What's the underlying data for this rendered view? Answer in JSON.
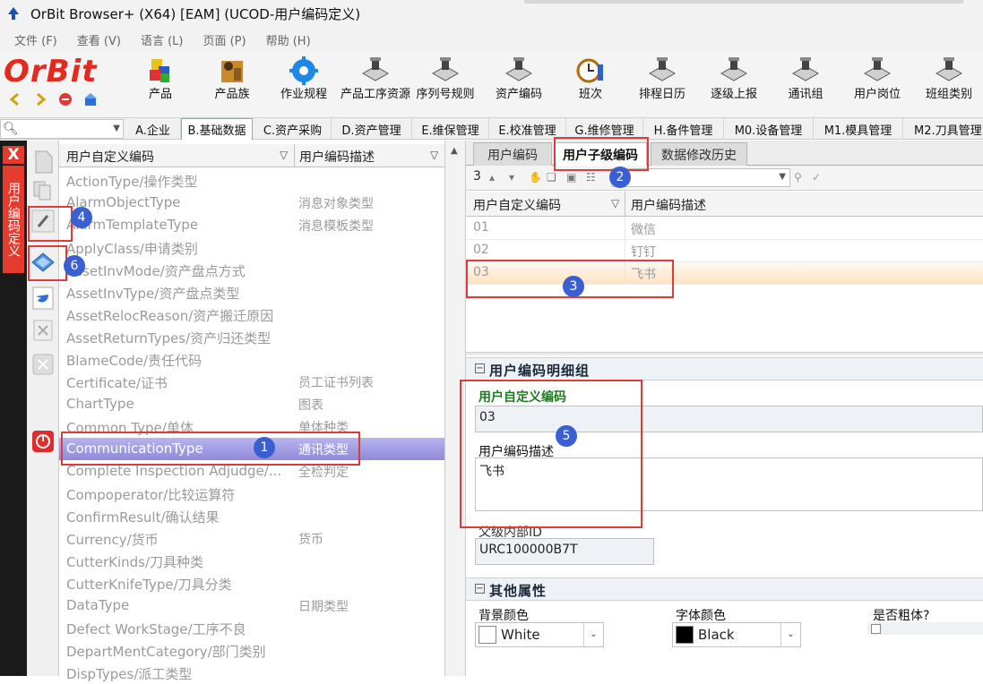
{
  "window": {
    "title": "OrBit Browser+ (X64) [EAM] (UCOD-用户编码定义)"
  },
  "menu": [
    "文件 (F)",
    "查看 (V)",
    "语言 (L)",
    "页面 (P)",
    "帮助 (H)"
  ],
  "logo": "OrBit",
  "toolbar": [
    {
      "label": "产品",
      "icon": "product-icon"
    },
    {
      "label": "产品族",
      "icon": "product-family-icon"
    },
    {
      "label": "作业规程",
      "icon": "gear-icon"
    },
    {
      "label": "产品工序资源",
      "icon": "process-resource-icon"
    },
    {
      "label": "序列号规则",
      "icon": "serial-rule-icon"
    },
    {
      "label": "资产编码",
      "icon": "asset-code-icon"
    },
    {
      "label": "班次",
      "icon": "clock-icon"
    },
    {
      "label": "排程日历",
      "icon": "calendar-icon"
    },
    {
      "label": "逐级上报",
      "icon": "report-icon"
    },
    {
      "label": "通讯组",
      "icon": "comm-group-icon"
    },
    {
      "label": "用户岗位",
      "icon": "user-post-icon"
    },
    {
      "label": "班组类别",
      "icon": "team-type-icon"
    }
  ],
  "module_tabs": [
    "A.企业",
    "B.基础数据",
    "C.资产采购",
    "D.资产管理",
    "E.维保管理",
    "E.校准管理",
    "G.维修管理",
    "H.备件管理",
    "M0.设备管理",
    "M1.模具管理",
    "M2.刀具管理"
  ],
  "active_module": "B.基础数据",
  "side_title": "用户编码定义",
  "list": {
    "col1": "用户自定义编码",
    "col2": "用户编码描述",
    "rows": [
      {
        "code": "ActionType/操作类型",
        "desc": ""
      },
      {
        "code": "AlarmObjectType",
        "desc": "消息对象类型"
      },
      {
        "code": "AlarmTemplateType",
        "desc": "消息模板类型"
      },
      {
        "code": "ApplyClass/申请类别",
        "desc": ""
      },
      {
        "code": "AssetInvMode/资产盘点方式",
        "desc": ""
      },
      {
        "code": "AssetInvType/资产盘点类型",
        "desc": ""
      },
      {
        "code": "AssetRelocReason/资产搬迁原因",
        "desc": ""
      },
      {
        "code": "AssetReturnTypes/资产归还类型",
        "desc": ""
      },
      {
        "code": "BlameCode/责任代码",
        "desc": ""
      },
      {
        "code": "Certificate/证书",
        "desc": "员工证书列表"
      },
      {
        "code": "ChartType",
        "desc": "图表"
      },
      {
        "code": "Common Type/单体",
        "desc": "单体种类"
      },
      {
        "code": "CommunicationType",
        "desc": "通讯类型"
      },
      {
        "code": "Complete Inspection Adjudge/...",
        "desc": "全检判定"
      },
      {
        "code": "Compoperator/比较运算符",
        "desc": ""
      },
      {
        "code": "ConfirmResult/确认结果",
        "desc": ""
      },
      {
        "code": "Currency/货币",
        "desc": "货币"
      },
      {
        "code": "CutterKinds/刀具种类",
        "desc": ""
      },
      {
        "code": "CutterKnifeType/刀具分类",
        "desc": ""
      },
      {
        "code": "DataType",
        "desc": "日期类型"
      },
      {
        "code": "Defect WorkStage/工序不良",
        "desc": ""
      },
      {
        "code": "DepartMentCategory/部门类别",
        "desc": ""
      },
      {
        "code": "DispTypes/派工类型",
        "desc": ""
      }
    ]
  },
  "right_tabs": [
    "用户编码",
    "用户子级编码",
    "数据修改历史"
  ],
  "active_right_tab": "用户子级编码",
  "record_count": "3",
  "grid": {
    "col1": "用户自定义编码",
    "col2": "用户编码描述",
    "rows": [
      {
        "code": "01",
        "desc": "微信"
      },
      {
        "code": "02",
        "desc": "钉钉"
      },
      {
        "code": "03",
        "desc": "飞书"
      }
    ]
  },
  "detail": {
    "section1": "用户编码明细组",
    "code_label": "用户自定义编码",
    "code_value": "03",
    "desc_label": "用户编码描述",
    "desc_value": "飞书",
    "parent_label": "父级内部ID",
    "parent_value": "URC100000B7T",
    "section2": "其他属性",
    "bg_label": "背景颜色",
    "bg_value": "White",
    "fg_label": "字体颜色",
    "fg_value": "Black",
    "bold_label": "是否粗体?"
  },
  "badges": [
    "1",
    "2",
    "3",
    "4",
    "5",
    "6"
  ],
  "colors": {
    "accent": "#e42a1f",
    "selection": "#9b97e0",
    "badge": "#3a5fd1",
    "highlight_box": "#e03b3b"
  }
}
